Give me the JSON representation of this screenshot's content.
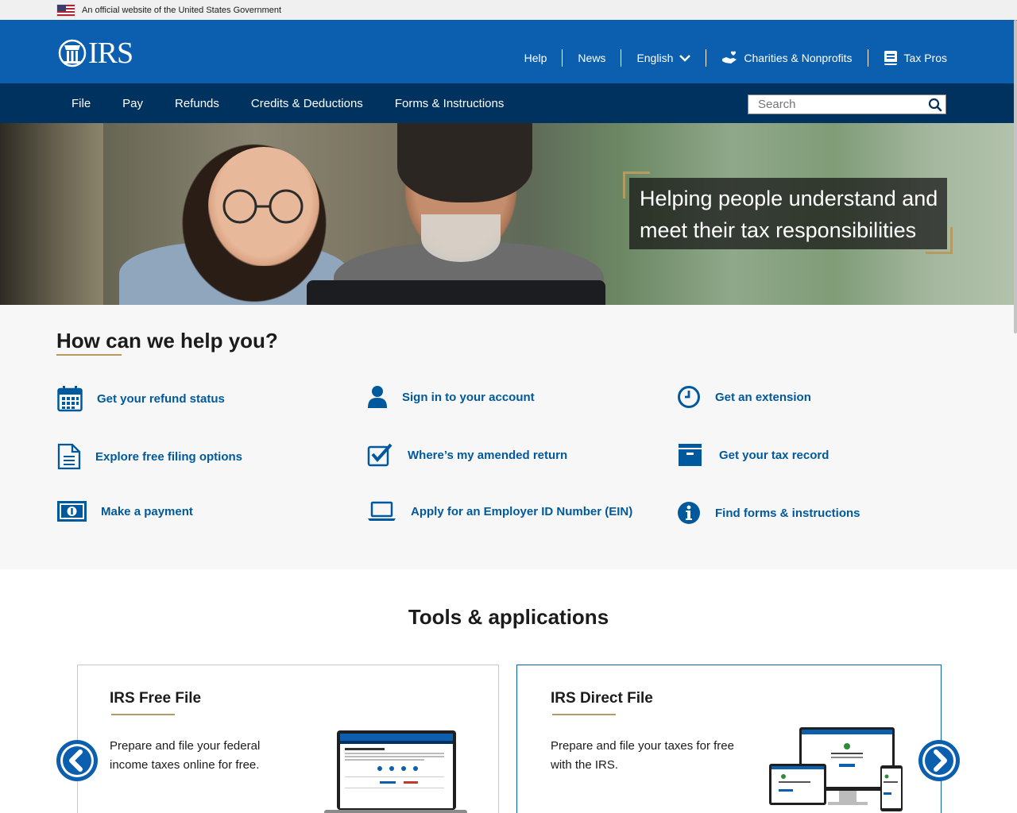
{
  "gov_banner": {
    "text": "An official website of the United States Government"
  },
  "header": {
    "logo_text": "IRS",
    "util_nav": {
      "help": "Help",
      "news": "News",
      "language": "English",
      "charities": "Charities & Nonprofits",
      "tax_pros": "Tax Pros"
    }
  },
  "main_nav": {
    "items": [
      "File",
      "Pay",
      "Refunds",
      "Credits & Deductions",
      "Forms & Instructions"
    ],
    "search_placeholder": "Search"
  },
  "hero": {
    "tagline_line1": "Helping people understand and",
    "tagline_line2": "meet their tax responsibilities"
  },
  "help": {
    "title": "How can we help you?",
    "links": [
      {
        "label": "Get your refund status",
        "icon": "calendar-icon"
      },
      {
        "label": "Sign in to your account",
        "icon": "user-icon"
      },
      {
        "label": "Get an extension",
        "icon": "clock-icon"
      },
      {
        "label": "Explore free filing options",
        "icon": "document-icon"
      },
      {
        "label": "Where’s my amended return",
        "icon": "checkbox-icon"
      },
      {
        "label": "Get your tax record",
        "icon": "archive-box-icon"
      },
      {
        "label": "Make a payment",
        "icon": "cash-icon"
      },
      {
        "label": "Apply for an Employer ID Number (EIN)",
        "icon": "laptop-icon"
      },
      {
        "label": "Find forms & instructions",
        "icon": "info-icon"
      }
    ]
  },
  "tools": {
    "title": "Tools & applications",
    "cards": [
      {
        "title": "IRS Free File",
        "desc_line1": "Prepare and file your federal",
        "desc_line2": "income taxes online for free."
      },
      {
        "title": "IRS Direct File",
        "desc_line1": "Prepare and file your taxes for free",
        "desc_line2": "with the IRS."
      }
    ]
  },
  "colors": {
    "header_blue": "#0b5fae",
    "nav_navy": "#00325f",
    "link_blue": "#00599c",
    "gold_accent": "#b59b62"
  }
}
